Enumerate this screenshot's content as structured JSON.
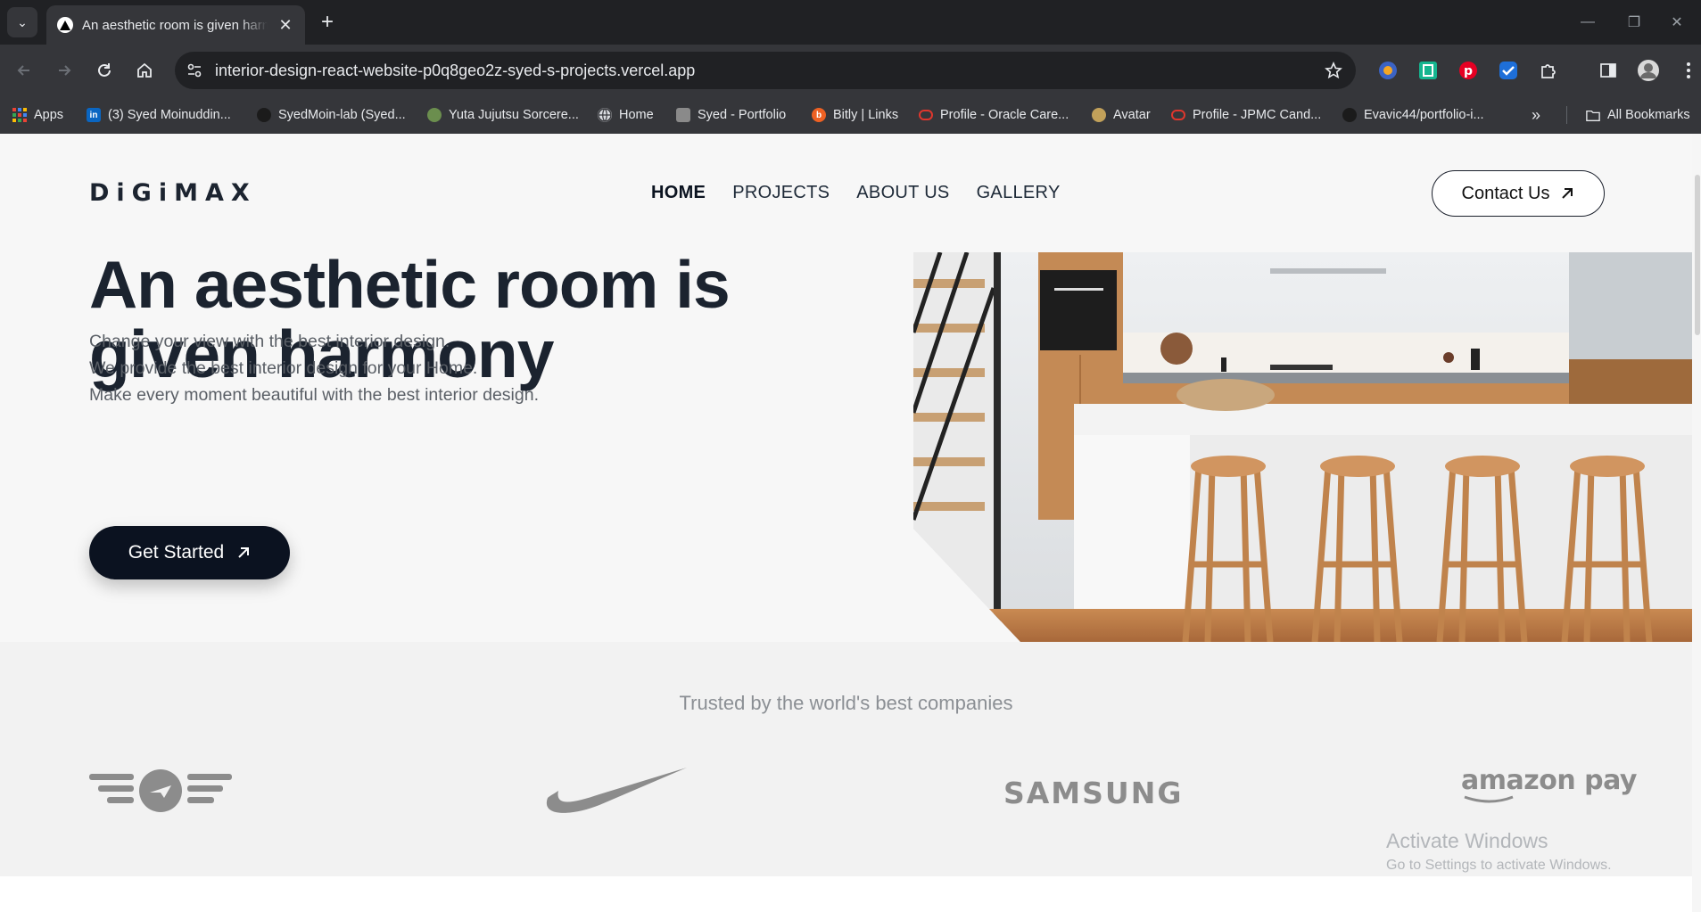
{
  "browser": {
    "tab_title": "An aesthetic room is given harmony",
    "url": "interior-design-react-website-p0q8geo2z-syed-s-projects.vercel.app",
    "bookmarks": [
      {
        "label": "Apps",
        "icon": "apps-grid-icon"
      },
      {
        "label": "(3) Syed Moinuddin...",
        "icon": "linkedin-icon"
      },
      {
        "label": "SyedMoin-lab (Syed...",
        "icon": "github-icon"
      },
      {
        "label": "Yuta Jujutsu Sorcere...",
        "icon": "anime-icon"
      },
      {
        "label": "Home",
        "icon": "globe-icon"
      },
      {
        "label": "Syed - Portfolio",
        "icon": "portfolio-icon"
      },
      {
        "label": "Bitly | Links",
        "icon": "bitly-icon"
      },
      {
        "label": "Profile - Oracle Care...",
        "icon": "oracle-icon"
      },
      {
        "label": "Avatar",
        "icon": "avatar-icon"
      },
      {
        "label": "Profile - JPMC Cand...",
        "icon": "oracle-icon"
      },
      {
        "label": "Evavic44/portfolio-i...",
        "icon": "github-icon"
      }
    ],
    "all_bookmarks_label": "All Bookmarks"
  },
  "site": {
    "logo_text": "DiGiMAX",
    "nav": [
      "HOME",
      "PROJECTS",
      "ABOUT US",
      "GALLERY"
    ],
    "contact_label": "Contact Us",
    "headline_1": "An aesthetic room is",
    "headline_2": "given harmony",
    "sublines": [
      "Change your view with the best interior design.",
      "We provide the best interior design for your Home.",
      "Make every moment beautiful with the best interior design."
    ],
    "cta_label": "Get Started",
    "trusted_title": "Trusted by the world's best companies",
    "brands": [
      "airline-wings-logo",
      "nike-swoosh-logo",
      "SAMSUNG",
      "amazon pay"
    ]
  },
  "os": {
    "watermark_title": "Activate Windows",
    "watermark_sub": "Go to Settings to activate Windows."
  },
  "colors": {
    "chrome_dark": "#202124",
    "chrome_toolbar": "#35363a",
    "heading": "#1b232f",
    "cta_bg": "#0b1220"
  }
}
